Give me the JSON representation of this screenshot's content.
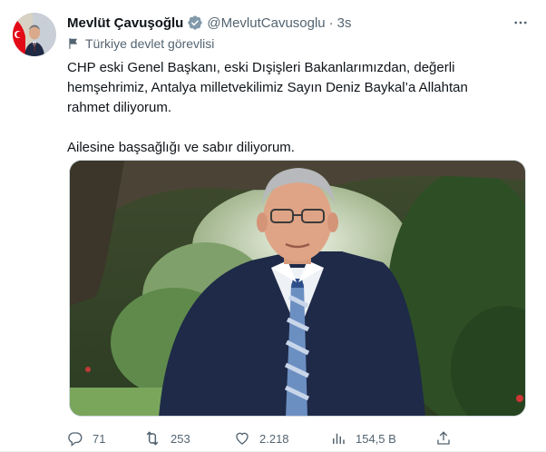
{
  "tweet": {
    "author_name": "Mevlüt Çavuşoğlu",
    "handle": "@MevlutCavusoglu",
    "separator": "·",
    "time": "3s",
    "affiliation": "Türkiye devlet görevlisi",
    "text_lines": [
      "CHP eski Genel Başkanı, eski Dışişleri Bakanlarımızdan, değerli",
      "hemşehrimiz, Antalya milletvekilimiz Sayın Deniz Baykal’a Allahtan",
      "rahmet diliyorum.",
      "Ailesine başsağlığı ve sabır diliyorum."
    ]
  },
  "actions": {
    "replies": "71",
    "retweets": "253",
    "likes": "2.218",
    "views": "154,5 B"
  },
  "icons": {
    "verified": "gray-verified-badge-icon",
    "affiliation": "flag-icon",
    "more": "more-options-icon",
    "reply": "reply-icon",
    "retweet": "retweet-icon",
    "like": "heart-icon",
    "views": "views-chart-icon",
    "share": "share-icon"
  },
  "colors": {
    "text": "#0f1419",
    "secondary": "#536471",
    "badge": "#829aab",
    "flag_red": "#e30a17"
  }
}
